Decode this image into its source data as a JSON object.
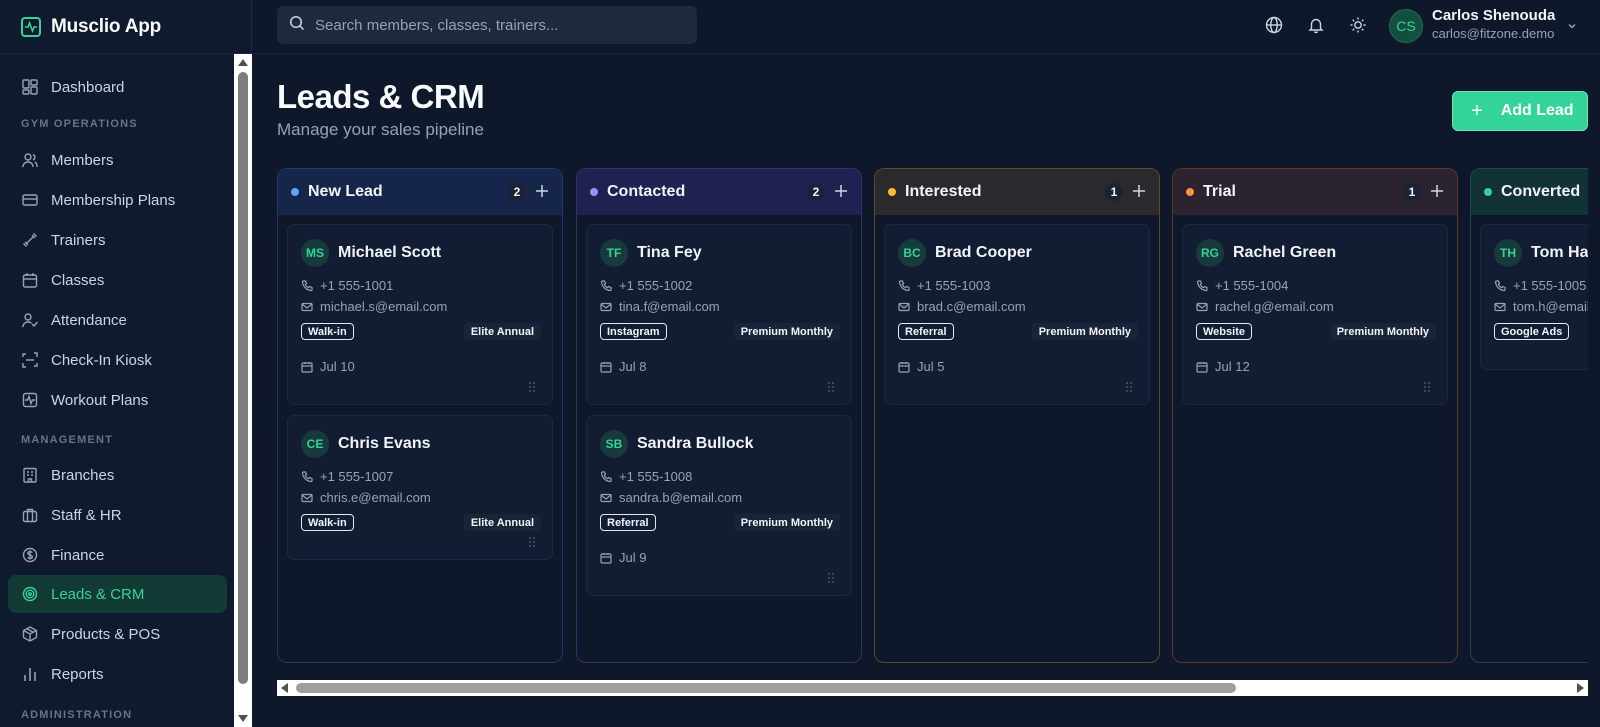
{
  "app": {
    "name": "Musclio App",
    "logo_icon": "activity-icon"
  },
  "search": {
    "placeholder": "Search members, classes, trainers..."
  },
  "user": {
    "initials": "CS",
    "name": "Carlos Shenouda",
    "email": "carlos@fitzone.demo"
  },
  "sidebar": {
    "sections": {
      "gym": "GYM OPERATIONS",
      "management": "MANAGEMENT",
      "admin": "ADMINISTRATION"
    },
    "items": [
      {
        "label": "Dashboard",
        "icon": "dashboard-icon"
      },
      {
        "label": "Members",
        "icon": "users-icon"
      },
      {
        "label": "Membership Plans",
        "icon": "credit-card-icon"
      },
      {
        "label": "Trainers",
        "icon": "dumbbell-icon"
      },
      {
        "label": "Classes",
        "icon": "calendar-icon"
      },
      {
        "label": "Attendance",
        "icon": "user-check-icon"
      },
      {
        "label": "Check-In Kiosk",
        "icon": "scan-icon"
      },
      {
        "label": "Workout Plans",
        "icon": "activity-icon"
      },
      {
        "label": "Branches",
        "icon": "building-icon"
      },
      {
        "label": "Staff & HR",
        "icon": "briefcase-icon"
      },
      {
        "label": "Finance",
        "icon": "dollar-icon"
      },
      {
        "label": "Leads & CRM",
        "icon": "target-icon",
        "active": true
      },
      {
        "label": "Products & POS",
        "icon": "package-icon"
      },
      {
        "label": "Reports",
        "icon": "bar-chart-icon"
      }
    ]
  },
  "page": {
    "title": "Leads & CRM",
    "subtitle": "Manage your sales pipeline",
    "add_button": "Add Lead"
  },
  "columns": [
    {
      "title": "New Lead",
      "count": "2",
      "color": "#60a5fa",
      "border": "#1e3a6b",
      "head_bg": "#16264a",
      "cards": [
        {
          "initials": "MS",
          "name": "Michael Scott",
          "phone": "+1 555-1001",
          "email": "michael.s@email.com",
          "source": "Walk-in",
          "plan": "Elite Annual",
          "date": "Jul 10"
        },
        {
          "initials": "CE",
          "name": "Chris Evans",
          "phone": "+1 555-1007",
          "email": "chris.e@email.com",
          "source": "Walk-in",
          "plan": "Elite Annual",
          "date": ""
        }
      ]
    },
    {
      "title": "Contacted",
      "count": "2",
      "color": "#a78bfa",
      "border": "#33306a",
      "head_bg": "#1f2150",
      "cards": [
        {
          "initials": "TF",
          "name": "Tina Fey",
          "phone": "+1 555-1002",
          "email": "tina.f@email.com",
          "source": "Instagram",
          "plan": "Premium Monthly",
          "date": "Jul 8"
        },
        {
          "initials": "SB",
          "name": "Sandra Bullock",
          "phone": "+1 555-1008",
          "email": "sandra.b@email.com",
          "source": "Referral",
          "plan": "Premium Monthly",
          "date": "Jul 9"
        }
      ]
    },
    {
      "title": "Interested",
      "count": "1",
      "color": "#fbbf24",
      "border": "#5e4a28",
      "head_bg": "#2a2a2e",
      "cards": [
        {
          "initials": "BC",
          "name": "Brad Cooper",
          "phone": "+1 555-1003",
          "email": "brad.c@email.com",
          "source": "Referral",
          "plan": "Premium Monthly",
          "date": "Jul 5"
        }
      ]
    },
    {
      "title": "Trial",
      "count": "1",
      "color": "#fb923c",
      "border": "#5e3526",
      "head_bg": "#2b2330",
      "cards": [
        {
          "initials": "RG",
          "name": "Rachel Green",
          "phone": "+1 555-1004",
          "email": "rachel.g@email.com",
          "source": "Website",
          "plan": "Premium Monthly",
          "date": "Jul 12"
        }
      ]
    },
    {
      "title": "Converted",
      "count": "",
      "color": "#34d399",
      "border": "#1b4a44",
      "head_bg": "#123336",
      "cards": [
        {
          "initials": "TH",
          "name": "Tom Hanks",
          "phone": "+1 555-1005",
          "email": "tom.h@email.com",
          "source": "Google Ads",
          "plan": "",
          "date": ""
        }
      ]
    }
  ]
}
